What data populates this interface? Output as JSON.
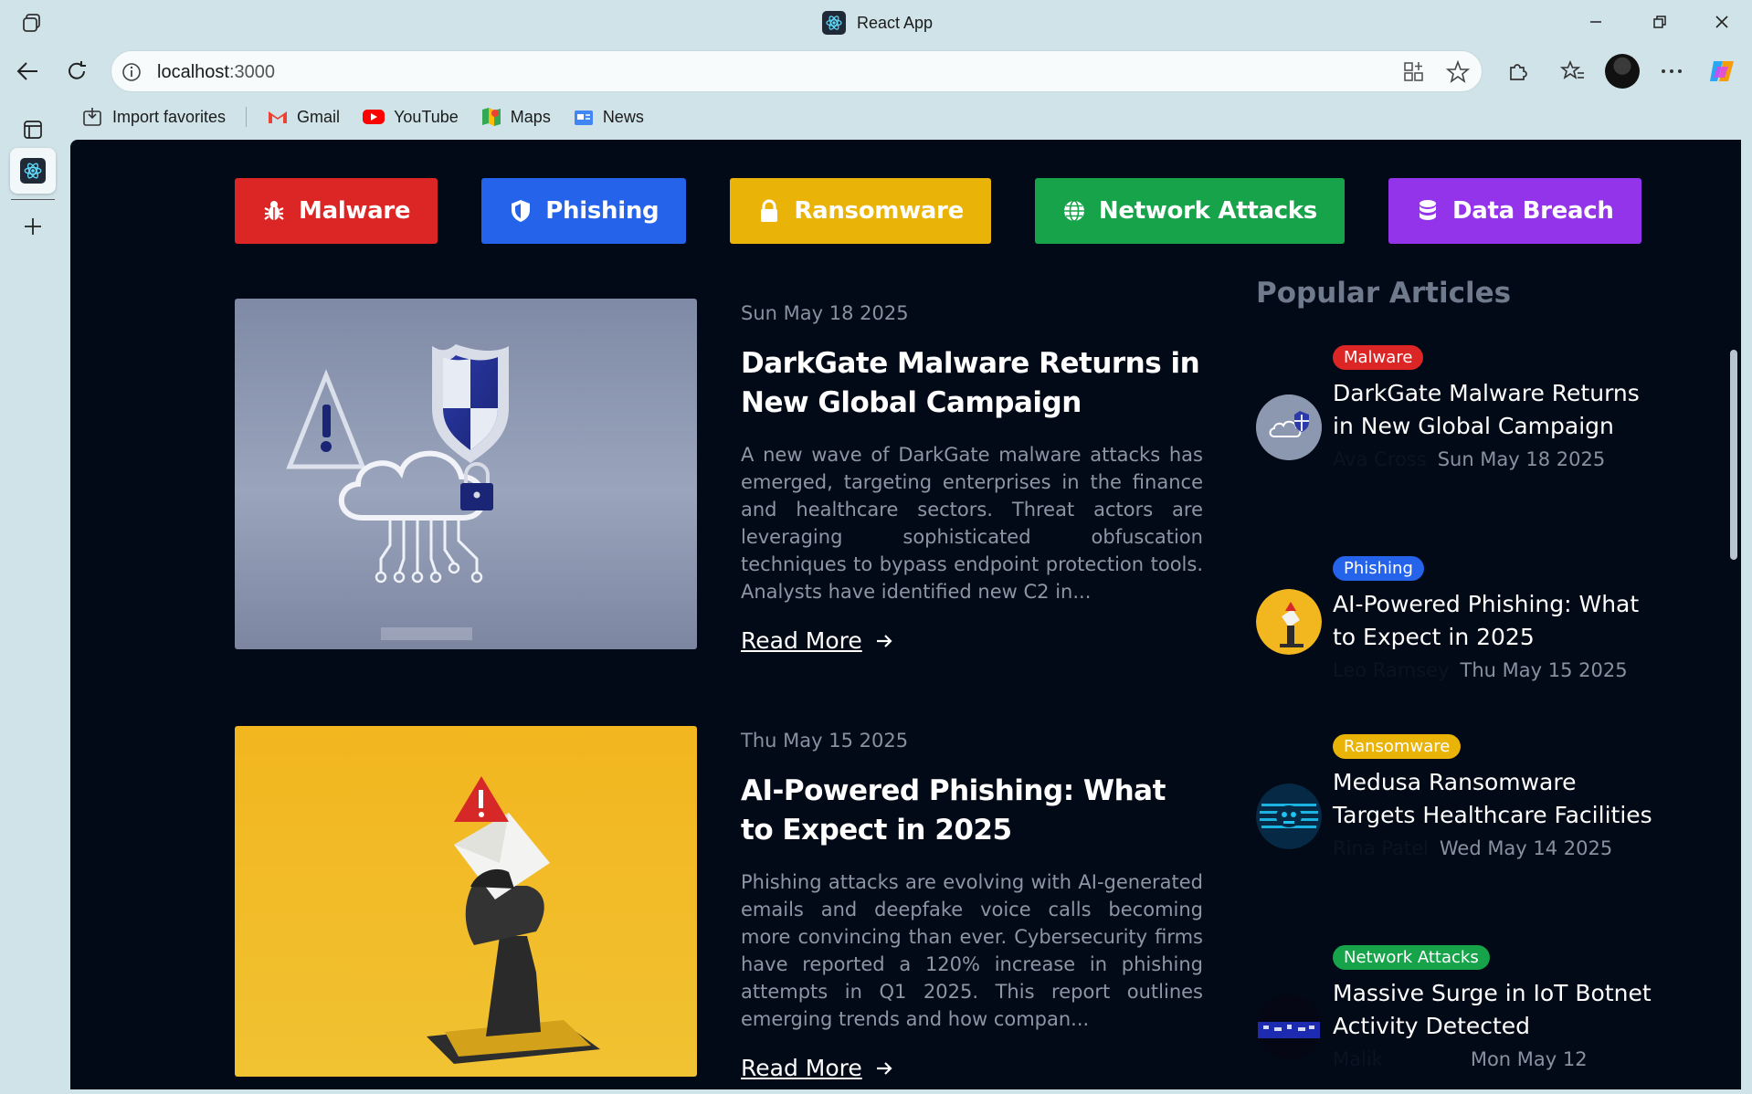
{
  "browser": {
    "tab_title": "React App",
    "url_host": "localhost",
    "url_port": ":3000",
    "bookmarks": [
      {
        "label": "Import favorites",
        "icon": "import-icon"
      },
      {
        "label": "Gmail",
        "icon": "gmail-icon"
      },
      {
        "label": "YouTube",
        "icon": "youtube-icon"
      },
      {
        "label": "Maps",
        "icon": "maps-icon"
      },
      {
        "label": "News",
        "icon": "news-icon"
      }
    ]
  },
  "categories": [
    {
      "label": "Malware",
      "icon": "bug-icon",
      "color": "#dc2626"
    },
    {
      "label": "Phishing",
      "icon": "shield-icon",
      "color": "#2563eb"
    },
    {
      "label": "Ransomware",
      "icon": "lock-icon",
      "color": "#eab308"
    },
    {
      "label": "Network Attacks",
      "icon": "globe-icon",
      "color": "#16a34a"
    },
    {
      "label": "Data Breach",
      "icon": "database-icon",
      "color": "#9333ea"
    }
  ],
  "articles": [
    {
      "date": "Sun May 18 2025",
      "title": "DarkGate Malware Returns in New Global Campaign",
      "excerpt": "A new wave of DarkGate malware attacks has emerged, targeting enterprises in the finance and healthcare sectors. Threat actors are leveraging sophisticated obfuscation techniques to bypass endpoint protection tools. Analysts have identified new C2 in...",
      "read_more": "Read More"
    },
    {
      "date": "Thu May 15 2025",
      "title": "AI-Powered Phishing: What to Expect in 2025",
      "excerpt": "Phishing attacks are evolving with AI-generated emails and deepfake voice calls becoming more convincing than ever. Cybersecurity firms have reported a 120% increase in phishing attempts in Q1 2025. This report outlines emerging trends and how compan...",
      "read_more": "Read More"
    }
  ],
  "popular": {
    "heading": "Popular Articles",
    "items": [
      {
        "badge": "Malware",
        "badge_color": "#dc2626",
        "title": "DarkGate Malware Returns in New Global Campaign",
        "author": "Ava Cross",
        "date": "Sun May 18 2025"
      },
      {
        "badge": "Phishing",
        "badge_color": "#2563eb",
        "title": "AI-Powered Phishing: What to Expect in 2025",
        "author": "Leo Ramsey",
        "date": "Thu May 15 2025"
      },
      {
        "badge": "Ransomware",
        "badge_color": "#eab308",
        "title": "Medusa Ransomware Targets Healthcare Facilities",
        "author": "Rina Patel",
        "date": "Wed May 14 2025"
      },
      {
        "badge": "Network Attacks",
        "badge_color": "#16a34a",
        "title": "Massive Surge in IoT Botnet Activity Detected",
        "author": "Malik",
        "date": "Mon May 12"
      }
    ]
  }
}
